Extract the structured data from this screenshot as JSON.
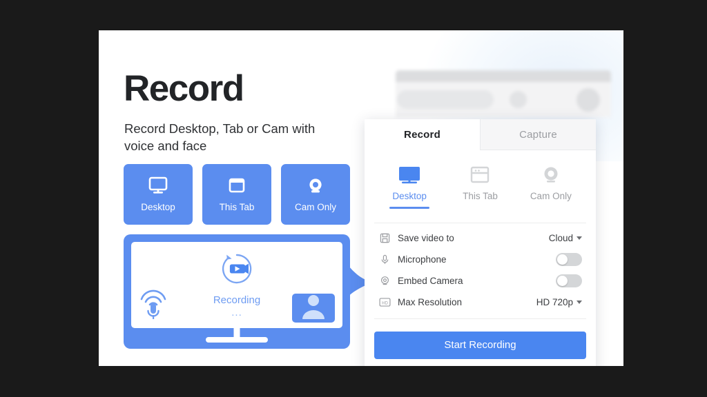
{
  "hero": {
    "title": "Record",
    "subtitle": "Record Desktop, Tab or Cam with voice and face"
  },
  "mode_cards": [
    {
      "label": "Desktop",
      "icon": "monitor-icon"
    },
    {
      "label": "This Tab",
      "icon": "browser-window-icon"
    },
    {
      "label": "Cam Only",
      "icon": "webcam-icon"
    }
  ],
  "illustration": {
    "status_label": "Recording",
    "status_dots": "...",
    "record_icon": "video-camera-record-icon",
    "mic_icon": "microphone-waves-icon",
    "cam_thumb_icon": "person-avatar-icon"
  },
  "browser": {
    "extension_icon": "screen-recorder-extension-icon"
  },
  "panel": {
    "tabs": [
      {
        "label": "Record",
        "active": true
      },
      {
        "label": "Capture",
        "active": false
      }
    ],
    "modes": [
      {
        "label": "Desktop",
        "icon": "monitor-icon",
        "active": true
      },
      {
        "label": "This Tab",
        "icon": "browser-window-icon",
        "active": false
      },
      {
        "label": "Cam Only",
        "icon": "webcam-icon",
        "active": false
      }
    ],
    "settings": [
      {
        "label": "Save video to",
        "icon": "floppy-save-icon",
        "control": "dropdown",
        "value": "Cloud"
      },
      {
        "label": "Microphone",
        "icon": "microphone-icon",
        "control": "toggle",
        "value": "off"
      },
      {
        "label": "Embed Camera",
        "icon": "webcam-icon",
        "control": "toggle",
        "value": "off"
      },
      {
        "label": "Max Resolution",
        "icon": "hd-badge-icon",
        "control": "dropdown",
        "value": "HD 720p"
      }
    ],
    "primary_button": "Start Recording"
  },
  "colors": {
    "brand_blue": "#5b8def",
    "button_blue": "#4a86f0",
    "canvas": "#1a1a1a",
    "card": "#ffffff",
    "muted_text": "#9b9da1"
  }
}
